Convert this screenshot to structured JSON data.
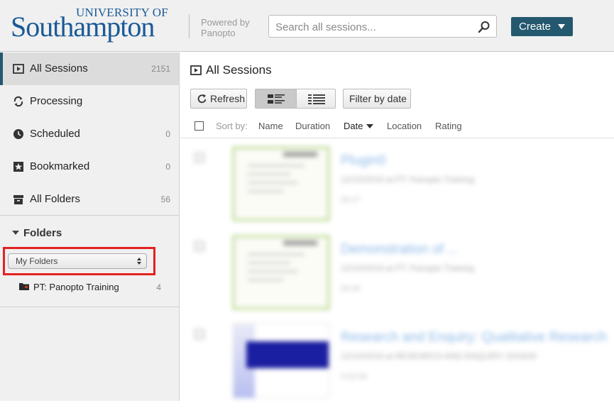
{
  "header": {
    "logo_top": "UNIVERSITY OF",
    "logo_main": "Southampton",
    "powered_line1": "Powered by",
    "powered_line2": "Panopto",
    "search_placeholder": "Search all sessions...",
    "create_label": "Create",
    "brand_color": "#1a5a96",
    "accent_color": "#24586f"
  },
  "sidebar": {
    "items": [
      {
        "label": "All Sessions",
        "count": "2151",
        "icon": "sessions-icon",
        "active": true
      },
      {
        "label": "Processing",
        "count": "",
        "icon": "processing-icon"
      },
      {
        "label": "Scheduled",
        "count": "0",
        "icon": "clock-icon"
      },
      {
        "label": "Bookmarked",
        "count": "0",
        "icon": "bookmark-icon"
      },
      {
        "label": "All Folders",
        "count": "56",
        "icon": "archive-icon"
      }
    ],
    "folders_heading": "Folders",
    "folder_select_value": "My Folders",
    "folders": [
      {
        "label": "PT: Panopto Training",
        "count": "4"
      }
    ]
  },
  "main": {
    "title": "All Sessions",
    "refresh_label": "Refresh",
    "filter_label": "Filter by date",
    "sort_label": "Sort by:",
    "sort_options": [
      "Name",
      "Duration",
      "Date",
      "Location",
      "Rating"
    ],
    "active_sort": "Date",
    "sessions": [
      {
        "title": "Plugin0",
        "meta": "12/10/2019 at PT: Panopto Training",
        "duration": "00:17"
      },
      {
        "title": "Demonstration of ...",
        "meta": "12/10/2019 at PT: Panopto Training",
        "duration": "00:09"
      },
      {
        "title": "Research and Enquiry: Qualitative Research",
        "meta": "12/10/2019 at RESEARCH AND ENQUIRY 2019/20",
        "duration": "0:22:09"
      }
    ]
  }
}
